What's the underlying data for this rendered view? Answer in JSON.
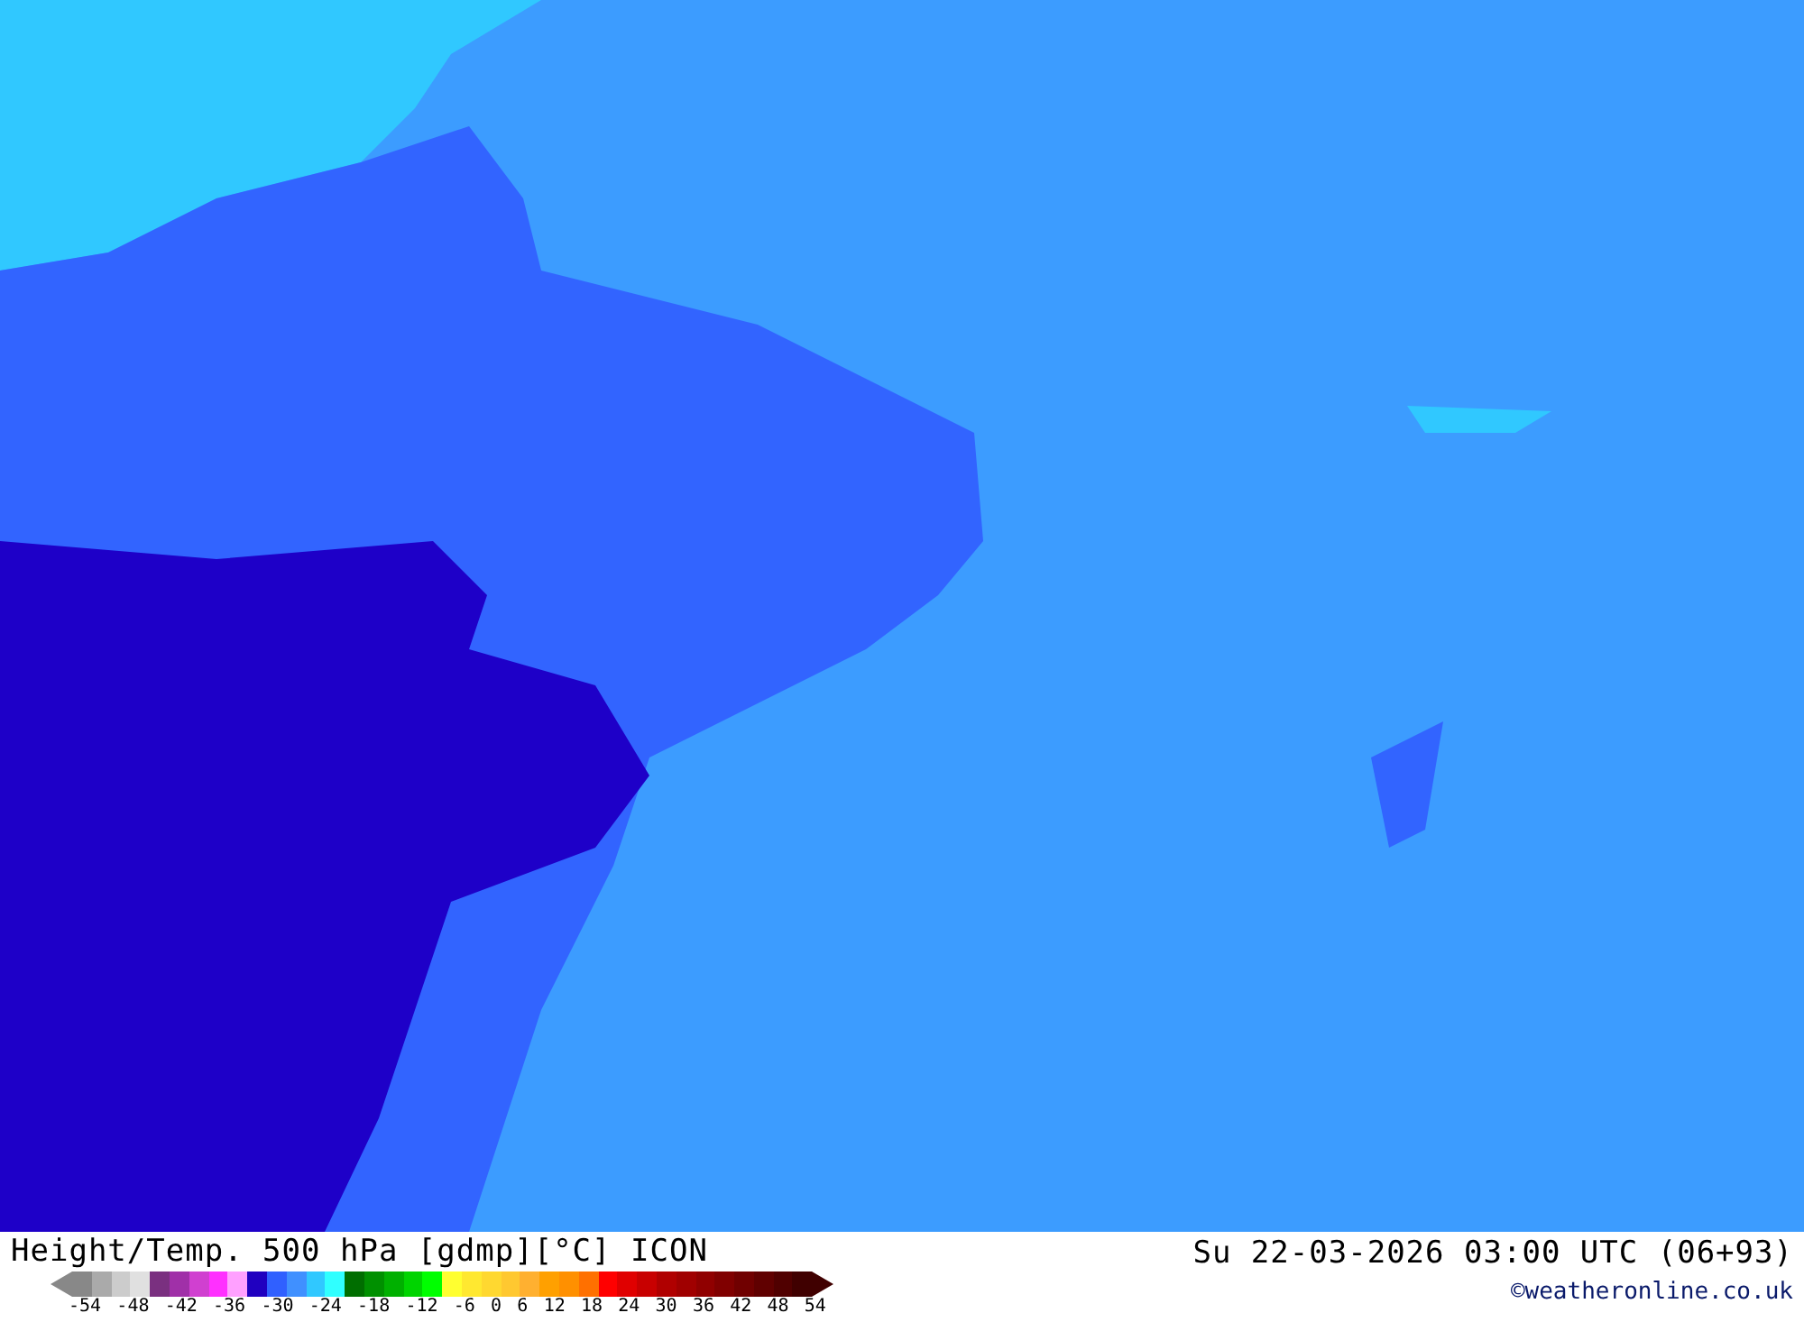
{
  "title": "Height/Temp. 500 hPa [gdmp][°C] ICON",
  "datetime": "Su 22-03-2026 03:00 UTC (06+93)",
  "credit": "©weatheronline.co.uk",
  "legend": {
    "swatches": [
      {
        "color": "#888888"
      },
      {
        "color": "#aaaaaa"
      },
      {
        "color": "#cccccc"
      },
      {
        "color": "#e0e0e0"
      },
      {
        "color": "#7a3080"
      },
      {
        "color": "#a030a8"
      },
      {
        "color": "#d040d0"
      },
      {
        "color": "#ff30ff"
      },
      {
        "color": "#ffa0ff"
      },
      {
        "color": "#2000c0"
      },
      {
        "color": "#3060ff"
      },
      {
        "color": "#4090ff"
      },
      {
        "color": "#30c8ff"
      },
      {
        "color": "#30ffff"
      },
      {
        "color": "#006e00"
      },
      {
        "color": "#009000"
      },
      {
        "color": "#00b000"
      },
      {
        "color": "#00d400"
      },
      {
        "color": "#00ff00"
      },
      {
        "color": "#ffff30"
      },
      {
        "color": "#ffe830"
      },
      {
        "color": "#ffd830"
      },
      {
        "color": "#ffc830"
      },
      {
        "color": "#ffb030"
      },
      {
        "color": "#ffa000"
      },
      {
        "color": "#ff9000"
      },
      {
        "color": "#ff7000"
      },
      {
        "color": "#ff0000"
      },
      {
        "color": "#e00000"
      },
      {
        "color": "#c80000"
      },
      {
        "color": "#b00000"
      },
      {
        "color": "#a00000"
      },
      {
        "color": "#900000"
      },
      {
        "color": "#800000"
      },
      {
        "color": "#700000"
      },
      {
        "color": "#600000"
      },
      {
        "color": "#500000"
      },
      {
        "color": "#400000"
      }
    ],
    "ticks": [
      "-54",
      "-48",
      "-42",
      "-36",
      "-30",
      "-24",
      "-18",
      "-12",
      "-6",
      "0",
      "6",
      "12",
      "18",
      "24",
      "30",
      "36",
      "42",
      "48",
      "54"
    ]
  }
}
